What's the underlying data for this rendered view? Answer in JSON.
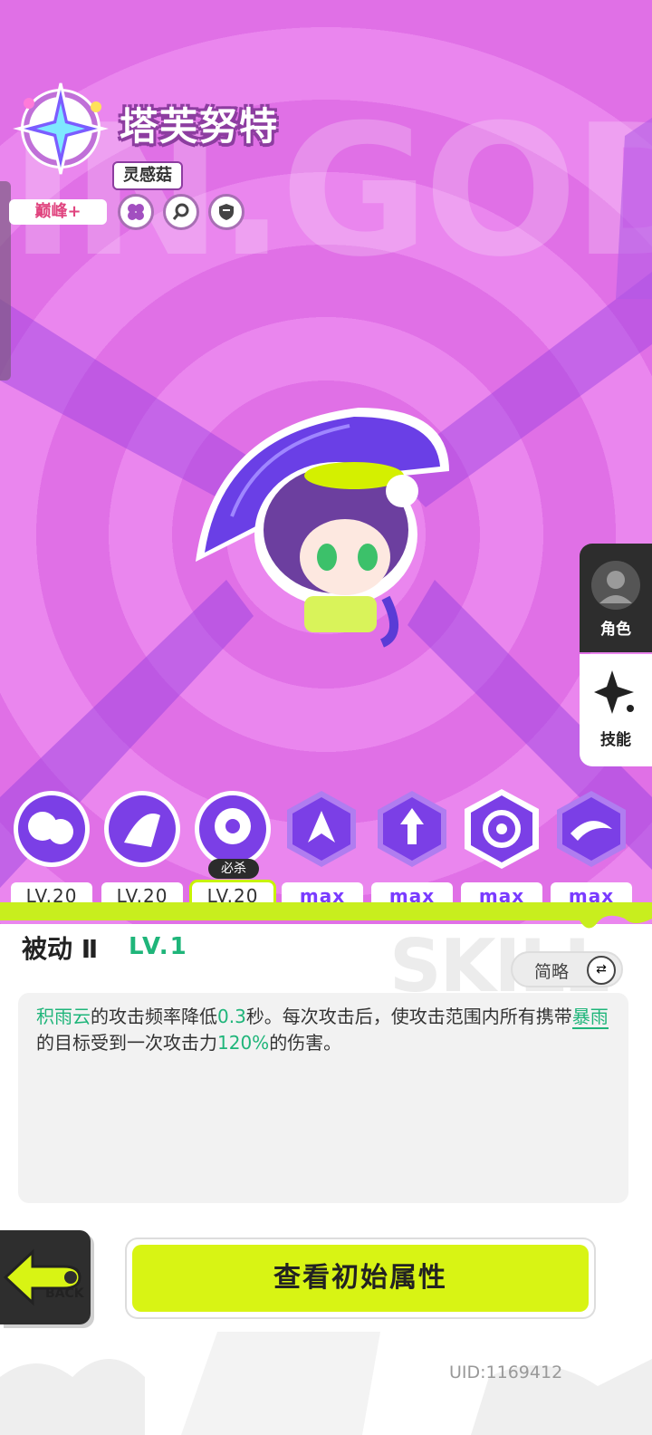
{
  "header": {
    "bg_word": "IN.GOD",
    "character_name": "塔芙努特",
    "subtitle_tag": "灵感菇",
    "rank_badge": "巅峰+"
  },
  "trait_icons": [
    "clover-icon",
    "magnifier-icon",
    "shield-icon"
  ],
  "side_tabs": {
    "role_label": "角色",
    "skill_label": "技能"
  },
  "skills": {
    "special_tag": "必杀",
    "levels": [
      "LV.20",
      "LV.20",
      "LV.20",
      "max",
      "max",
      "max",
      "max"
    ]
  },
  "skill_detail": {
    "name": "被动 Ⅱ",
    "level": "LV.1",
    "watermark": "SKILL",
    "brief_label": "简略",
    "desc_part1": "积雨云",
    "desc_part2": "的攻击频率降低",
    "desc_part3": "0.3",
    "desc_part4": "秒。每次攻击后，使攻击范围内所有携带",
    "desc_part5": "暴雨",
    "desc_part6": "的目标受到一次攻击力",
    "desc_part7": "120%",
    "desc_part8": "的伤害。"
  },
  "footer": {
    "back_label": "BACK",
    "main_button": "查看初始属性",
    "uid": "UID:1169412"
  },
  "colors": {
    "bg_pink": "#e070e6",
    "accent_green": "#1fb57a",
    "button_lime": "#d8f414",
    "max_purple": "#7a3bff"
  }
}
